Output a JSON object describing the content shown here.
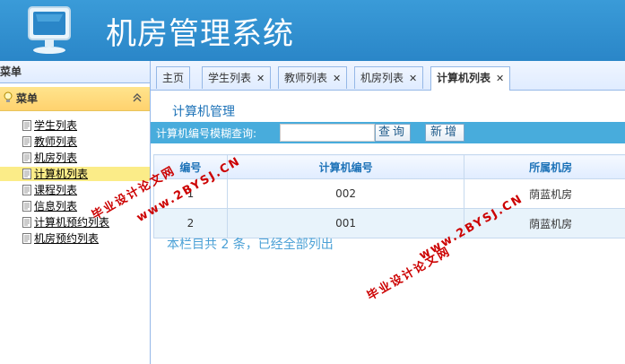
{
  "header": {
    "title": "机房管理系统"
  },
  "sidebar": {
    "panel_title": "菜单",
    "accordion_title": "菜单",
    "items": [
      {
        "label": "学生列表"
      },
      {
        "label": "教师列表"
      },
      {
        "label": "机房列表"
      },
      {
        "label": "计算机列表"
      },
      {
        "label": "课程列表"
      },
      {
        "label": "信息列表"
      },
      {
        "label": "计算机预约列表"
      },
      {
        "label": "机房预约列表"
      }
    ]
  },
  "tabs": [
    {
      "label": "主页"
    },
    {
      "label": "学生列表"
    },
    {
      "label": "教师列表"
    },
    {
      "label": "机房列表"
    },
    {
      "label": "计算机列表"
    }
  ],
  "main": {
    "section_title": "计算机管理",
    "search_label": "计算机编号模糊查询:",
    "search_value": "",
    "search_button": "查询",
    "add_button": "新增",
    "columns": [
      "编号",
      "计算机编号",
      "所属机房"
    ],
    "rows": [
      [
        "1",
        "002",
        "荫蓝机房"
      ],
      [
        "2",
        "001",
        "荫蓝机房"
      ]
    ],
    "count_text": "本栏目共 2 条，已经全部列出"
  },
  "watermarks": {
    "text_a": "毕业设计论文网",
    "text_b": "www.2BYSJ.CN"
  },
  "colors": {
    "header": "#2a86c8",
    "toolbar": "#48acdc",
    "accordion": "#ffd26e",
    "watermark": "#cc0000"
  }
}
